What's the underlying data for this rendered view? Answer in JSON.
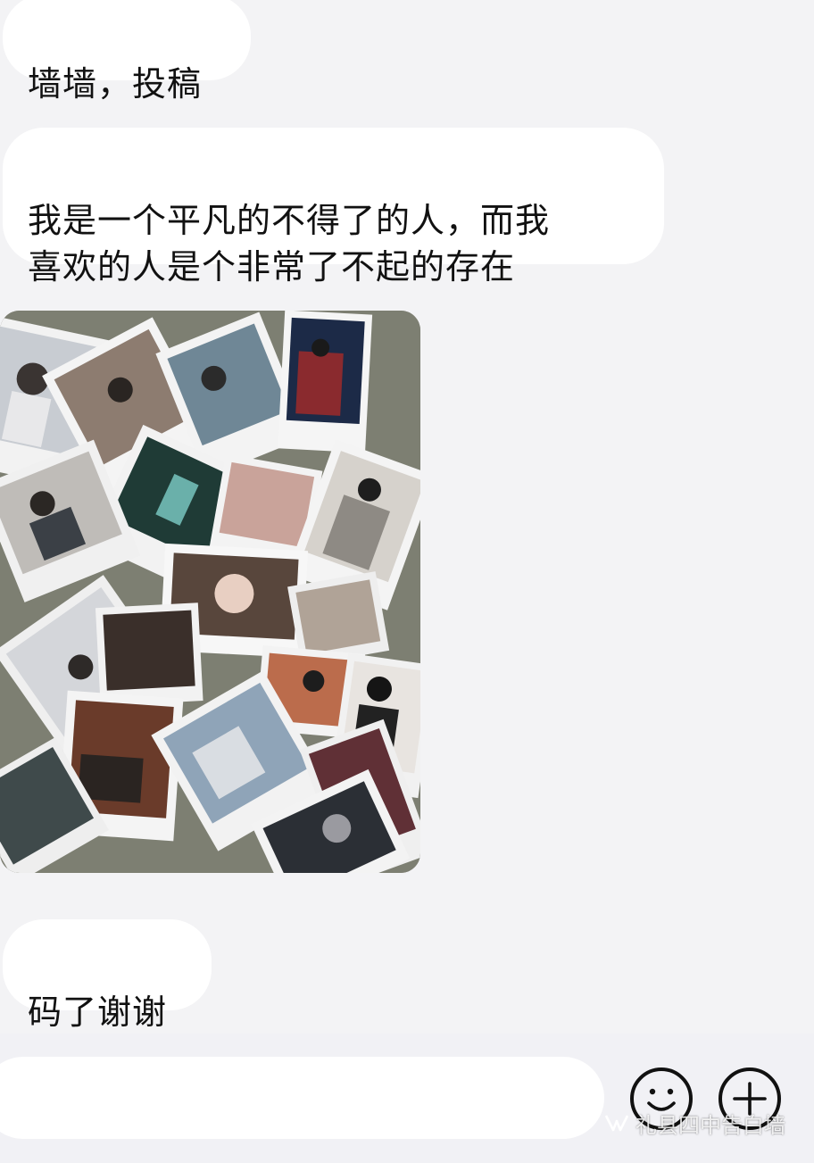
{
  "messages": [
    {
      "text": "墙墙，投稿"
    },
    {
      "text": "我是一个平凡的不得了的人，而我\n喜欢的人是个非常了不起的存在"
    },
    {
      "text": "码了谢谢"
    }
  ],
  "image": {
    "subject": "scattered polaroid photos"
  },
  "input": {
    "value": "",
    "placeholder": ""
  },
  "icons": {
    "emoji": "smiley-face-icon",
    "add": "plus-circle-icon",
    "watermark": "wechat-channel-icon"
  },
  "watermark": {
    "text": "礼县四中告白墙"
  },
  "colors": {
    "background": "#f3f3f5",
    "bubble": "#ffffff",
    "text": "#111111"
  }
}
